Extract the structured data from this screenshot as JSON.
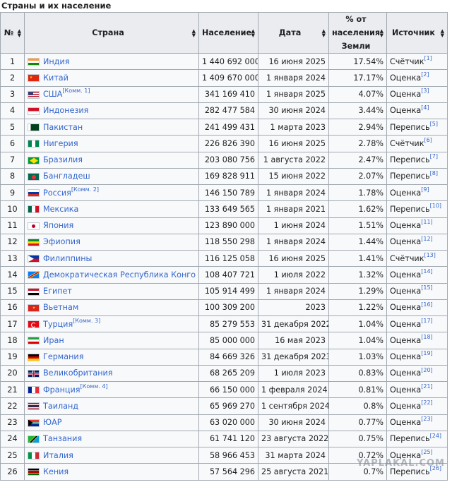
{
  "caption": "Страны и их население",
  "headers": {
    "rank": "№",
    "country": "Страна",
    "population": "Население",
    "date": "Дата",
    "percent_line1": "% от",
    "percent_line2": "населения",
    "percent_line3": "Земли",
    "source": "Источник"
  },
  "rows": [
    {
      "rank": "1",
      "country": "Индия",
      "note": "",
      "population": "1 440 692 000",
      "date": "16 июня 2025",
      "percent": "17.54%",
      "source": "Счётчик",
      "ref": "[1]",
      "flag": "india"
    },
    {
      "rank": "2",
      "country": "Китай",
      "note": "",
      "population": "1 409 670 000",
      "date": "1 января 2024",
      "percent": "17.17%",
      "source": "Оценка",
      "ref": "[2]",
      "flag": "china"
    },
    {
      "rank": "3",
      "country": "США",
      "note": "[Комм. 1]",
      "population": "341 169 410",
      "date": "1 января 2025",
      "percent": "4.07%",
      "source": "Оценка",
      "ref": "[3]",
      "flag": "usa"
    },
    {
      "rank": "4",
      "country": "Индонезия",
      "note": "",
      "population": "282 477 584",
      "date": "30 июня 2024",
      "percent": "3.44%",
      "source": "Оценка",
      "ref": "[4]",
      "flag": "indonesia"
    },
    {
      "rank": "5",
      "country": "Пакистан",
      "note": "",
      "population": "241 499 431",
      "date": "1 марта 2023",
      "percent": "2.94%",
      "source": "Перепись",
      "ref": "[5]",
      "flag": "pakistan"
    },
    {
      "rank": "6",
      "country": "Нигерия",
      "note": "",
      "population": "226 826 390",
      "date": "16 июня 2025",
      "percent": "2.78%",
      "source": "Счётчик",
      "ref": "[6]",
      "flag": "nigeria"
    },
    {
      "rank": "7",
      "country": "Бразилия",
      "note": "",
      "population": "203 080 756",
      "date": "1 августа 2022",
      "percent": "2.47%",
      "source": "Перепись",
      "ref": "[7]",
      "flag": "brazil"
    },
    {
      "rank": "8",
      "country": "Бангладеш",
      "note": "",
      "population": "169 828 911",
      "date": "15 июня 2022",
      "percent": "2.07%",
      "source": "Перепись",
      "ref": "[8]",
      "flag": "bangladesh"
    },
    {
      "rank": "9",
      "country": "Россия",
      "note": "[Комм. 2]",
      "population": "146 150 789",
      "date": "1 января 2024",
      "percent": "1.78%",
      "source": "Оценка",
      "ref": "[9]",
      "flag": "russia"
    },
    {
      "rank": "10",
      "country": "Мексика",
      "note": "",
      "population": "133 649 565",
      "date": "1 января 2021",
      "percent": "1.62%",
      "source": "Перепись",
      "ref": "[10]",
      "flag": "mexico"
    },
    {
      "rank": "11",
      "country": "Япония",
      "note": "",
      "population": "123 890 000",
      "date": "1 июня 2024",
      "percent": "1.51%",
      "source": "Оценка",
      "ref": "[11]",
      "flag": "japan"
    },
    {
      "rank": "12",
      "country": "Эфиопия",
      "note": "",
      "population": "118 550 298",
      "date": "1 января 2024",
      "percent": "1.44%",
      "source": "Оценка",
      "ref": "[12]",
      "flag": "ethiopia"
    },
    {
      "rank": "13",
      "country": "Филиппины",
      "note": "",
      "population": "116 125 058",
      "date": "16 июня 2025",
      "percent": "1.41%",
      "source": "Счётчик",
      "ref": "[13]",
      "flag": "philippines"
    },
    {
      "rank": "14",
      "country": "Демократическая Республика Конго",
      "note": "",
      "population": "108 407 721",
      "date": "1 июля 2022",
      "percent": "1.32%",
      "source": "Оценка",
      "ref": "[14]",
      "flag": "drc"
    },
    {
      "rank": "15",
      "country": "Египет",
      "note": "",
      "population": "105 914 499",
      "date": "1 января 2024",
      "percent": "1.29%",
      "source": "Оценка",
      "ref": "[15]",
      "flag": "egypt"
    },
    {
      "rank": "16",
      "country": "Вьетнам",
      "note": "",
      "population": "100 309 200",
      "date": "2023",
      "percent": "1.22%",
      "source": "Оценка",
      "ref": "[16]",
      "flag": "vietnam"
    },
    {
      "rank": "17",
      "country": "Турция",
      "note": "[Комм. 3]",
      "population": "85 279 553",
      "date": "31 декабря 2022",
      "percent": "1.04%",
      "source": "Оценка",
      "ref": "[17]",
      "flag": "turkey"
    },
    {
      "rank": "18",
      "country": "Иран",
      "note": "",
      "population": "85 000 000",
      "date": "16 мая 2023",
      "percent": "1.04%",
      "source": "Оценка",
      "ref": "[18]",
      "flag": "iran"
    },
    {
      "rank": "19",
      "country": "Германия",
      "note": "",
      "population": "84 669 326",
      "date": "31 декабря 2023",
      "percent": "1.03%",
      "source": "Оценка",
      "ref": "[19]",
      "flag": "germany"
    },
    {
      "rank": "20",
      "country": "Великобритания",
      "note": "",
      "population": "68 265 209",
      "date": "1 июля 2023",
      "percent": "0.83%",
      "source": "Оценка",
      "ref": "[20]",
      "flag": "uk"
    },
    {
      "rank": "21",
      "country": "Франция",
      "note": "[Комм. 4]",
      "population": "66 150 000",
      "date": "1 февраля 2024",
      "percent": "0.81%",
      "source": "Оценка",
      "ref": "[21]",
      "flag": "france"
    },
    {
      "rank": "22",
      "country": "Таиланд",
      "note": "",
      "population": "65 969 270",
      "date": "1 сентября 2024",
      "percent": "0.8%",
      "source": "Оценка",
      "ref": "[22]",
      "flag": "thailand"
    },
    {
      "rank": "23",
      "country": "ЮАР",
      "note": "",
      "population": "63 020 000",
      "date": "30 июня 2024",
      "percent": "0.77%",
      "source": "Оценка",
      "ref": "[23]",
      "flag": "southafrica"
    },
    {
      "rank": "24",
      "country": "Танзания",
      "note": "",
      "population": "61 741 120",
      "date": "23 августа 2022",
      "percent": "0.75%",
      "source": "Перепись",
      "ref": "[24]",
      "flag": "tanzania"
    },
    {
      "rank": "25",
      "country": "Италия",
      "note": "",
      "population": "58 966 453",
      "date": "31 марта 2024",
      "percent": "0.72%",
      "source": "Оценка",
      "ref": "[25]",
      "flag": "italy"
    },
    {
      "rank": "26",
      "country": "Кения",
      "note": "",
      "population": "57 564 296",
      "date": "25 августа 2021",
      "percent": "0.7%",
      "source": "Перепись",
      "ref": "[26]",
      "flag": "kenya"
    }
  ],
  "watermark": "YAPLAKAL.COM",
  "colors": {
    "link": "#3366cc",
    "header_bg": "#eaecf0",
    "cell_bg": "#f8f9fa",
    "border": "#a2a9b1"
  }
}
